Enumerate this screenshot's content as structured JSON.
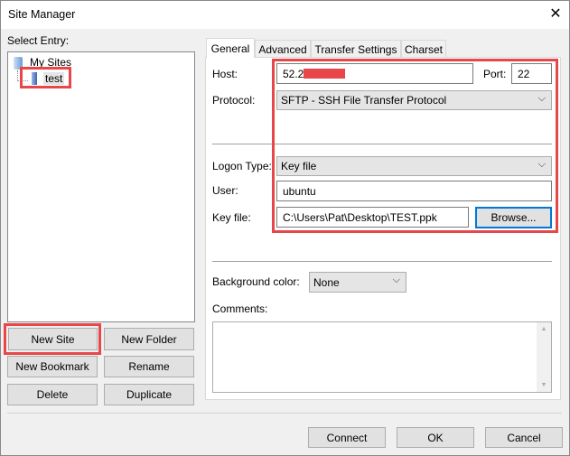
{
  "window": {
    "title": "Site Manager",
    "close_icon": "close-icon"
  },
  "left": {
    "select_entry_label": "Select Entry:",
    "tree": {
      "root": "My Sites",
      "child": "test"
    },
    "buttons": {
      "new_site": "New Site",
      "new_folder": "New Folder",
      "new_bookmark": "New Bookmark",
      "rename": "Rename",
      "delete": "Delete",
      "duplicate": "Duplicate"
    }
  },
  "tabs": [
    {
      "label": "General",
      "active": true
    },
    {
      "label": "Advanced"
    },
    {
      "label": "Transfer Settings"
    },
    {
      "label": "Charset"
    }
  ],
  "general": {
    "host_label": "Host:",
    "host_value": "52.2",
    "port_label": "Port:",
    "port_value": "22",
    "protocol_label": "Protocol:",
    "protocol_value": "SFTP - SSH File Transfer Protocol",
    "logon_type_label": "Logon Type:",
    "logon_type_value": "Key file",
    "user_label": "User:",
    "user_value": "ubuntu",
    "key_file_label": "Key file:",
    "key_file_value": "C:\\Users\\Pat\\Desktop\\TEST.ppk",
    "browse_label": "Browse...",
    "bg_color_label": "Background color:",
    "bg_color_value": "None",
    "comments_label": "Comments:"
  },
  "footer": {
    "connect": "Connect",
    "ok": "OK",
    "cancel": "Cancel"
  },
  "colors": {
    "highlight": "#e8474a",
    "focus": "#0078d7"
  }
}
